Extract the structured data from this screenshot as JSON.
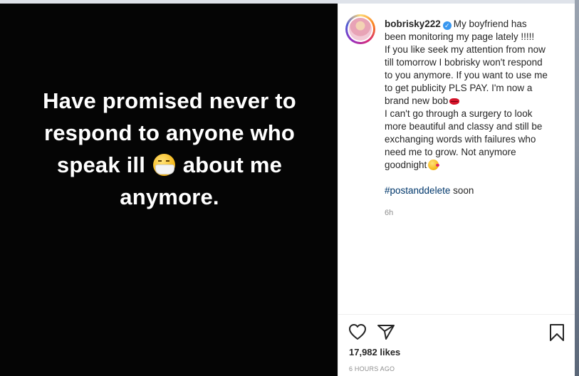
{
  "post": {
    "image_text_lines": [
      "Have promised never to",
      "respond to anyone who",
      "speak ill",
      "about me",
      "anymore."
    ],
    "image_emoji": "face-with-medical-mask"
  },
  "caption": {
    "username": "bobrisky222",
    "lines": [
      "My boyfriend has",
      "been monitoring my page lately !!!!!",
      "If you like seek my attention from now",
      "till tomorrow I bobrisky won't respond",
      "to you anymore. If you want to use me",
      "to get publicity PLS PAY. I'm now a",
      "brand new bob",
      "I can't go through a surgery to look",
      "more beautiful and classy and still be",
      "exchanging words with failures who",
      "need me to grow. Not anymore",
      "goodnight"
    ],
    "hashtag": "#postanddelete",
    "hashtag_suffix": " soon",
    "relative_time": "6h"
  },
  "actions": {
    "like_icon": "heart-icon",
    "share_icon": "send-icon",
    "save_icon": "bookmark-icon"
  },
  "stats": {
    "likes": "17,982 likes",
    "timestamp": "6 HOURS AGO"
  },
  "colors": {
    "post_background": "#050505",
    "text_primary": "#262626",
    "text_secondary": "#8e8e8e",
    "hashtag": "#00376b",
    "verified": "#3897f0"
  }
}
